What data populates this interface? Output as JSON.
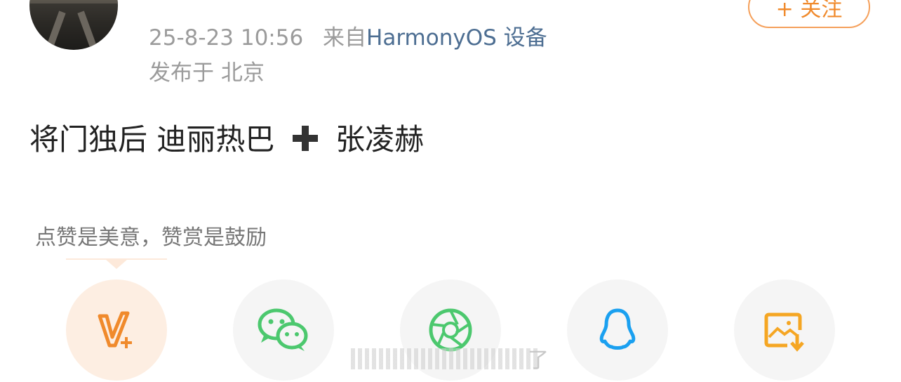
{
  "post": {
    "username": "",
    "follow_label": "+ 关注",
    "time": "25-8-23 10:56",
    "source_prefix": "来自",
    "source": "HarmonyOS 设备",
    "location": "发布于 北京",
    "text_part1": "将门独后 迪丽热巴",
    "text_part2": "张凌赫"
  },
  "reward": {
    "hint": "点赞是美意，赞赏是鼓励"
  },
  "share": {
    "items": [
      {
        "name": "vip-reward",
        "color": "#f08a2c"
      },
      {
        "name": "wechat",
        "color": "#4cc86e"
      },
      {
        "name": "moments",
        "color": "#4cc86e"
      },
      {
        "name": "qq",
        "color": "#1aa0f0"
      },
      {
        "name": "save-image",
        "color": "#f5a623"
      }
    ]
  },
  "watermark": {
    "visible_char": "了"
  }
}
